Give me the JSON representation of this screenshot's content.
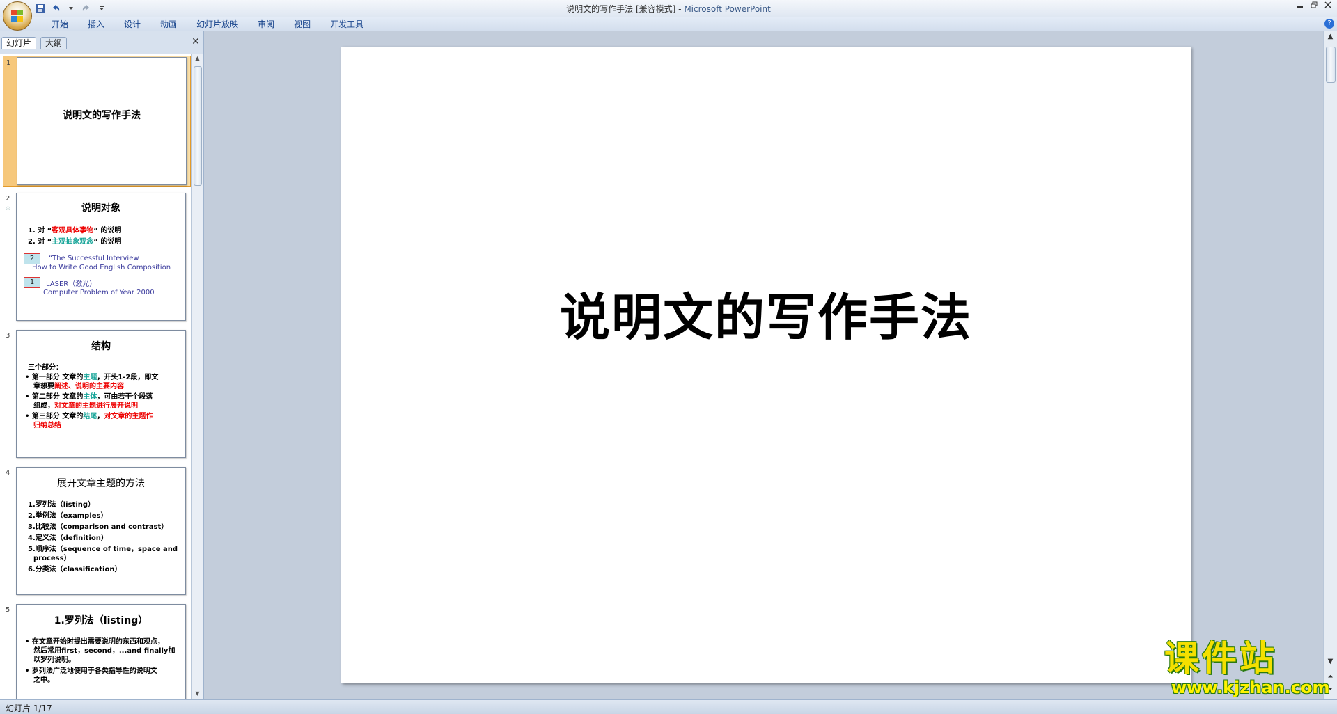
{
  "window": {
    "doc_name": "说明文的写作手法 [兼容模式]",
    "separator": " - ",
    "app_name": "Microsoft PowerPoint"
  },
  "ribbon": {
    "tabs": [
      "开始",
      "插入",
      "设计",
      "动画",
      "幻灯片放映",
      "审阅",
      "视图",
      "开发工具"
    ]
  },
  "panel": {
    "tab_slides": "幻灯片",
    "tab_outline": "大纲"
  },
  "thumbnails": [
    {
      "num": "1",
      "title": "说明文的写作手法"
    },
    {
      "num": "2",
      "title": "说明对象",
      "line1_pre": "1.  对 “",
      "line1_hl": "客观具体事物",
      "line1_post": "” 的说明",
      "line2_pre": "2.  对 “",
      "line2_hl": "主观抽象观念",
      "line2_post": "” 的说明",
      "box1": "2",
      "ref1_a": "“The Successful Interview",
      "ref1_b": "How to Write Good English Composition",
      "box2": "1",
      "ref2_a": "LASER（激光）",
      "ref2_b": "Computer Problem of Year 2000"
    },
    {
      "num": "3",
      "title": "结构",
      "intro": "三个部分：",
      "b1_a": "第一部分   文章的",
      "b1_hl": "主题",
      "b1_b": "，开头1-2段，即文",
      "b1_c": "章想要",
      "b1_hl2": "阐述、说明的主要内容",
      "b2_a": "第二部分   文章的",
      "b2_hl": "主体",
      "b2_b": "，可由若干个段落",
      "b2_c": "组成，",
      "b2_hl2": "对文章的主题进行展开说明",
      "b3_a": "第三部分   文章的",
      "b3_hl": "结尾",
      "b3_b": "，",
      "b3_hl2": "对文章的主题作",
      "b3_hl3": "归纳总结"
    },
    {
      "num": "4",
      "title": "展开文章主题的方法",
      "items": [
        "1.罗列法（listing）",
        "2.举例法（examples）",
        "3.比较法（comparison and contrast）",
        "4.定义法（definition）",
        "5.顺序法（sequence of time，space and",
        "process）",
        "6.分类法（classification）"
      ]
    },
    {
      "num": "5",
      "title": "1.罗列法（listing）",
      "lines": [
        "在文章开始时提出需要说明的东西和观点，",
        "然后常用first，second，...and finally加",
        "以罗列说明。",
        "罗列法广泛地使用于各类指导性的说明文",
        "之中。"
      ]
    }
  ],
  "slide": {
    "title": "说明文的写作手法"
  },
  "status": {
    "slide_info": "幻灯片 1/17"
  },
  "watermark": {
    "cn": "课件站",
    "url": "www.kjzhan.com"
  }
}
